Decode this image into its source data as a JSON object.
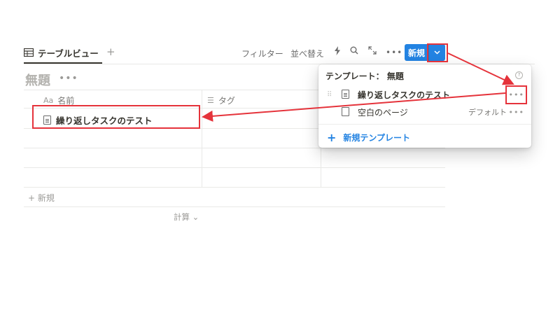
{
  "view_tab": {
    "label": "テーブルビュー",
    "add": "+"
  },
  "toolbar": {
    "filter": "フィルター",
    "sort": "並べ替え",
    "lightning_icon": "lightning-icon",
    "search_icon": "search-icon",
    "expand_icon": "expand-icon",
    "more": "•••",
    "new_button": "新規",
    "new_chevron": "⌄"
  },
  "database": {
    "title": "無題",
    "more": "•••"
  },
  "table": {
    "columns": [
      {
        "icon": "Aa",
        "label": "名前"
      },
      {
        "icon": "☰",
        "label": "タグ"
      }
    ],
    "rows": [
      {
        "title": "繰り返しタスクのテスト"
      }
    ],
    "add_row": "+ 新規",
    "calculate": "計算 ⌄"
  },
  "template_popup": {
    "title_prefix": "テンプレート：",
    "title_name": "無題",
    "help": "?",
    "items": [
      {
        "label": "繰り返しタスクのテスト",
        "more": "•••"
      },
      {
        "label": "空白のページ",
        "badge": "デフォルト",
        "more": "•••"
      }
    ],
    "new_template": "新規テンプレート",
    "new_template_plus": "+"
  },
  "colors": {
    "accent": "#2383e2",
    "annotation": "#e5333b"
  }
}
